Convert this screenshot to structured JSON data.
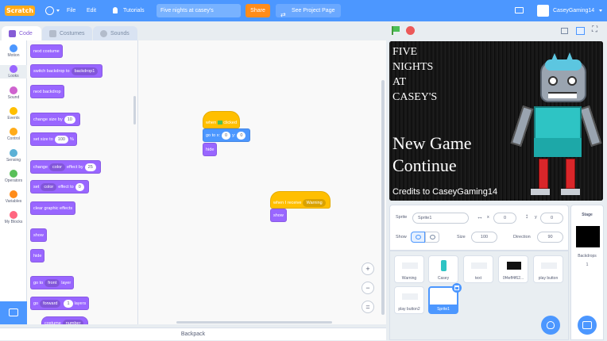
{
  "menubar": {
    "logo": "Scratch",
    "file": "File",
    "edit": "Edit",
    "tutorials": "Tutorials",
    "project_title": "Five nights at casey's",
    "share": "Share",
    "see_project_page": "See Project Page",
    "username": "CaseyGaming14"
  },
  "tabs": {
    "code": "Code",
    "costumes": "Costumes",
    "sounds": "Sounds"
  },
  "categories": [
    {
      "label": "Motion",
      "color": "#4c97ff"
    },
    {
      "label": "Looks",
      "color": "#9966ff"
    },
    {
      "label": "Sound",
      "color": "#cf63cf"
    },
    {
      "label": "Events",
      "color": "#ffbf00"
    },
    {
      "label": "Control",
      "color": "#ffab19"
    },
    {
      "label": "Sensing",
      "color": "#5cb1d6"
    },
    {
      "label": "Operators",
      "color": "#59c059"
    },
    {
      "label": "Variables",
      "color": "#ff8c1a"
    },
    {
      "label": "My Blocks",
      "color": "#ff6680"
    }
  ],
  "palette": {
    "next_costume": "next costume",
    "switch_backdrop": "switch backdrop to",
    "backdrop_value": "backdrop1",
    "next_backdrop": "next backdrop",
    "change_size": "change size by",
    "change_size_value": "10",
    "set_size": "set size to",
    "set_size_value": "100",
    "percent": "%",
    "change_effect": "change",
    "effect_color": "color",
    "effect_by": "effect by",
    "effect_by_value": "25",
    "set_effect": "set",
    "effect_to": "effect to",
    "effect_to_value": "0",
    "clear_effects": "clear graphic effects",
    "show": "show",
    "hide": "hide",
    "go_to": "go to",
    "front": "front",
    "layer": "layer",
    "go": "go",
    "forward": "forward",
    "layers_value": "1",
    "layers": "layers",
    "costume": "costume",
    "number": "number"
  },
  "script1": {
    "when": "when",
    "clicked": "clicked",
    "goto_x": "go to x:",
    "x_value": "0",
    "y": "y:",
    "y_value": "0",
    "hide": "hide"
  },
  "script2": {
    "when_receive": "when I receive",
    "message": "Warning",
    "show": "show"
  },
  "workspace": {
    "zoom_in": "+",
    "zoom_out": "−",
    "zoom_reset": "="
  },
  "backpack": "Backpack",
  "stage": {
    "line1": "FIVE",
    "line2": "NIGHTS",
    "line3": "AT",
    "line4": "CASEY'S",
    "new_game": "New Game",
    "continue": "Continue",
    "credits": "Credits to CaseyGaming14"
  },
  "sprite_info": {
    "sprite_label": "Sprite",
    "sprite_name": "Sprite1",
    "x_label": "x",
    "x_value": "0",
    "y_label": "y",
    "y_value": "0",
    "show_label": "Show",
    "size_label": "Size",
    "size_value": "100",
    "direction_label": "Direction",
    "direction_value": "90"
  },
  "sprites": [
    "Warning",
    "Casey",
    "text",
    "0f4eff4f62...",
    "play button",
    "play button2",
    "Sprite1"
  ],
  "stage_panel": {
    "title": "Stage",
    "backdrops_label": "Backdrops",
    "backdrops_count": "1"
  },
  "colors": {
    "accent": "#4c97ff",
    "share": "#ff8c1a",
    "looks": "#9966ff",
    "events": "#ffbf00",
    "green_flag": "#4cbf56",
    "stop": "#ec5959"
  }
}
